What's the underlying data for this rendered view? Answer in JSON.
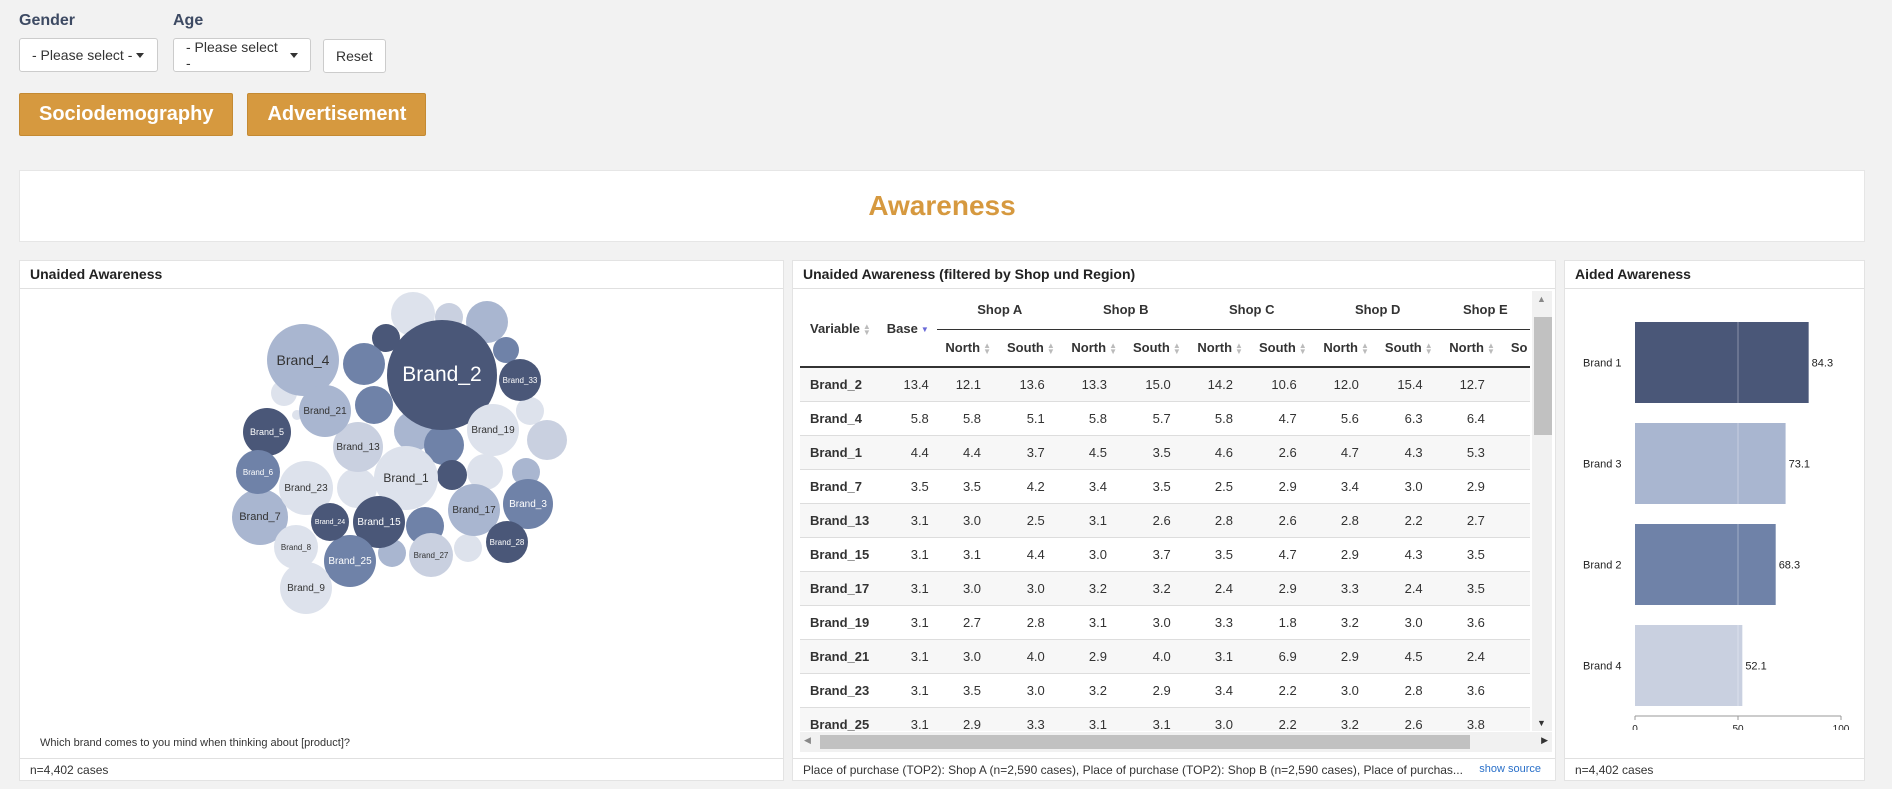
{
  "filters": {
    "gender": {
      "label": "Gender",
      "value": "- Please select -"
    },
    "age": {
      "label": "Age",
      "value": "- Please select -"
    },
    "reset_label": "Reset"
  },
  "tabs": [
    {
      "label": "Sociodemography"
    },
    {
      "label": "Advertisement"
    }
  ],
  "page_title": "Awareness",
  "bubble_panel": {
    "title": "Unaided Awareness",
    "question": "Which brand comes to you mind when thinking about [product]?",
    "footer": "n=4,402 cases",
    "bubbles": [
      {
        "label": "Brand_2",
        "shade": "dark"
      },
      {
        "label": "Brand_4",
        "shade": "medium-light"
      },
      {
        "label": "Brand_1",
        "shade": "lightest"
      },
      {
        "label": "Brand_7",
        "shade": "medium-light"
      },
      {
        "label": "Brand_13",
        "shade": "light"
      },
      {
        "label": "Brand_15",
        "shade": "dark"
      },
      {
        "label": "Brand_17",
        "shade": "medium-light"
      },
      {
        "label": "Brand_19",
        "shade": "lightest"
      },
      {
        "label": "Brand_21",
        "shade": "medium-light"
      },
      {
        "label": "Brand_23",
        "shade": "lightest"
      },
      {
        "label": "Brand_25",
        "shade": "medium"
      },
      {
        "label": "Brand_3",
        "shade": "medium"
      },
      {
        "label": "Brand_5",
        "shade": "dark"
      },
      {
        "label": "Brand_6",
        "shade": "medium"
      },
      {
        "label": "Brand_8",
        "shade": "lightest"
      },
      {
        "label": "Brand_9",
        "shade": "lightest"
      },
      {
        "label": "Brand_27",
        "shade": "light"
      },
      {
        "label": "Brand_28",
        "shade": "dark"
      },
      {
        "label": "Brand_24",
        "shade": "dark"
      },
      {
        "label": "Brand_33",
        "shade": "dark"
      }
    ]
  },
  "table_panel": {
    "title": "Unaided Awareness (filtered by Shop und Region)",
    "footer": "Place of purchase (TOP2): Shop A (n=2,590 cases), Place of purchase (TOP2): Shop B (n=2,590 cases), Place of purchas...",
    "show_source": "show source",
    "col_variable": "Variable",
    "col_base": "Base",
    "shops": [
      "Shop A",
      "Shop B",
      "Shop C",
      "Shop D",
      "Shop E"
    ],
    "regions": [
      "North",
      "South",
      "North",
      "South",
      "North",
      "South",
      "North",
      "South",
      "North",
      "So"
    ],
    "rows": [
      {
        "variable": "Brand_2",
        "values": [
          "13.4",
          "12.1",
          "13.6",
          "13.3",
          "15.0",
          "14.2",
          "10.6",
          "12.0",
          "15.4",
          "12.7"
        ]
      },
      {
        "variable": "Brand_4",
        "values": [
          "5.8",
          "5.8",
          "5.1",
          "5.8",
          "5.7",
          "5.8",
          "4.7",
          "5.6",
          "6.3",
          "6.4"
        ]
      },
      {
        "variable": "Brand_1",
        "values": [
          "4.4",
          "4.4",
          "3.7",
          "4.5",
          "3.5",
          "4.6",
          "2.6",
          "4.7",
          "4.3",
          "5.3"
        ]
      },
      {
        "variable": "Brand_7",
        "values": [
          "3.5",
          "3.5",
          "4.2",
          "3.4",
          "3.5",
          "2.5",
          "2.9",
          "3.4",
          "3.0",
          "2.9"
        ]
      },
      {
        "variable": "Brand_13",
        "values": [
          "3.1",
          "3.0",
          "2.5",
          "3.1",
          "2.6",
          "2.8",
          "2.6",
          "2.8",
          "2.2",
          "2.7"
        ]
      },
      {
        "variable": "Brand_15",
        "values": [
          "3.1",
          "3.1",
          "4.4",
          "3.0",
          "3.7",
          "3.5",
          "4.7",
          "2.9",
          "4.3",
          "3.5"
        ]
      },
      {
        "variable": "Brand_17",
        "values": [
          "3.1",
          "3.0",
          "3.0",
          "3.2",
          "3.2",
          "2.4",
          "2.9",
          "3.3",
          "2.4",
          "3.5"
        ]
      },
      {
        "variable": "Brand_19",
        "values": [
          "3.1",
          "2.7",
          "2.8",
          "3.1",
          "3.0",
          "3.3",
          "1.8",
          "3.2",
          "3.0",
          "3.6"
        ]
      },
      {
        "variable": "Brand_21",
        "values": [
          "3.1",
          "3.0",
          "4.0",
          "2.9",
          "4.0",
          "3.1",
          "6.9",
          "2.9",
          "4.5",
          "2.4"
        ]
      },
      {
        "variable": "Brand_23",
        "values": [
          "3.1",
          "3.5",
          "3.0",
          "3.2",
          "2.9",
          "3.4",
          "2.2",
          "3.0",
          "2.8",
          "3.6"
        ]
      },
      {
        "variable": "Brand_25",
        "values": [
          "3.1",
          "2.9",
          "3.3",
          "3.1",
          "3.1",
          "3.0",
          "2.2",
          "3.2",
          "2.6",
          "3.8"
        ]
      }
    ]
  },
  "bar_panel": {
    "title": "Aided Awareness",
    "footer": "n=4,402 cases",
    "chart_data": {
      "type": "bar",
      "orientation": "horizontal",
      "categories": [
        "Brand 1",
        "Brand 3",
        "Brand 2",
        "Brand 4"
      ],
      "values": [
        84.3,
        73.1,
        68.3,
        52.1
      ],
      "xlim": [
        0,
        100
      ],
      "xticks": [
        "0",
        "50",
        "100"
      ],
      "colors": [
        "#4a5778",
        "#a9b6d0",
        "#6f82a8",
        "#c9d0e0"
      ]
    }
  },
  "colors": {
    "accent": "#d6993f",
    "dark": "#4a5778",
    "medium": "#6f82a8",
    "medium-light": "#a9b6d0",
    "light": "#c9d0e0",
    "lightest": "#dde2ec"
  }
}
